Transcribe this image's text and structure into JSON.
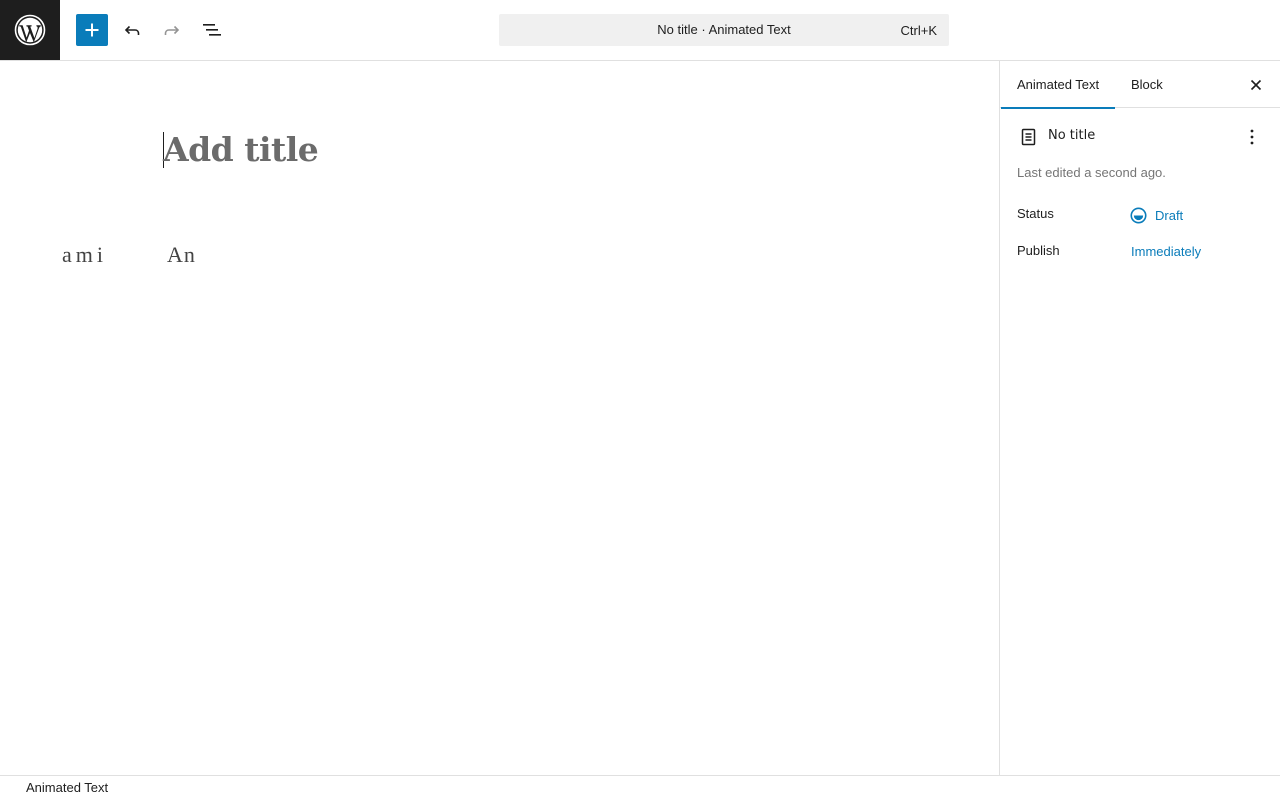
{
  "topbar": {
    "logo_icon": "wordpress-logo-icon",
    "add_icon": "plus-icon",
    "undo_icon": "undo-icon",
    "redo_icon": "redo-icon",
    "listview_icon": "list-view-icon",
    "command_bar": {
      "title": "No title · Animated Text",
      "shortcut": "Ctrl+K"
    }
  },
  "canvas": {
    "title_placeholder": "Add title",
    "animated_fragment_1": "ami",
    "animated_fragment_2": "An"
  },
  "sidebar": {
    "tabs": [
      {
        "label": "Animated Text",
        "active": true
      },
      {
        "label": "Block",
        "active": false
      }
    ],
    "close_icon": "close-icon",
    "document": {
      "icon": "page-icon",
      "title": "No title",
      "menu_icon": "more-vertical-icon",
      "last_edited": "Last edited a second ago."
    },
    "status": {
      "label": "Status",
      "value": "Draft",
      "icon": "draft-status-icon"
    },
    "publish": {
      "label": "Publish",
      "value": "Immediately"
    }
  },
  "footer": {
    "breadcrumb": "Animated Text"
  },
  "colors": {
    "accent": "#0a7cba",
    "logo_bg": "#1e1e1e",
    "command_bar_bg": "#f0f0f0"
  }
}
